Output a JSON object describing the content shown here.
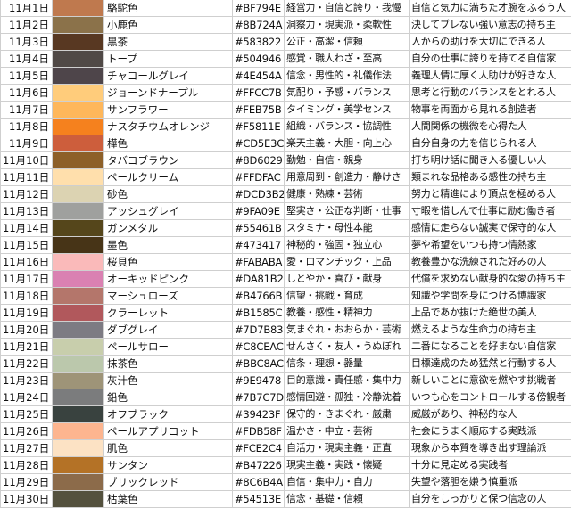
{
  "rows": [
    {
      "date": "11月1日",
      "color": "#BF794E",
      "name": "駱駝色",
      "hex": "#BF794E",
      "traits": "経営力・自信と誇り・我慢",
      "desc": "自信と気力に満ちた才腕をふるう人"
    },
    {
      "date": "11月2日",
      "color": "#8B724A",
      "name": "小鹿色",
      "hex": "#8B724A",
      "traits": "洞察力・現実派・柔軟性",
      "desc": "決してブレない強い意志の持ち主"
    },
    {
      "date": "11月3日",
      "color": "#583822",
      "name": "黒茶",
      "hex": "#583822",
      "traits": "公正・高潔・信頼",
      "desc": "人からの助けを大切にできる人"
    },
    {
      "date": "11月4日",
      "color": "#504946",
      "name": "トープ",
      "hex": "#504946",
      "traits": "感覚・職人わざ・至高",
      "desc": "自分の仕事に誇りを持てる自信家"
    },
    {
      "date": "11月5日",
      "color": "#4E454A",
      "name": "チャコールグレイ",
      "hex": "#4E454A",
      "traits": "信念・男性的・礼儀作法",
      "desc": "義理人情に厚く人助けが好きな人"
    },
    {
      "date": "11月6日",
      "color": "#FFCC7B",
      "name": "ジョーンドナープル",
      "hex": "#FFCC7B",
      "traits": "気配り・予感・バランス",
      "desc": "思考と行動のバランスをとれる人"
    },
    {
      "date": "11月7日",
      "color": "#FEB75B",
      "name": "サンフラワー",
      "hex": "#FEB75B",
      "traits": "タイミング・美学センス",
      "desc": "物事を両面から見れる創造者"
    },
    {
      "date": "11月8日",
      "color": "#F5811E",
      "name": "ナスタチウムオレンジ",
      "hex": "#F5811E",
      "traits": "組織・バランス・協調性",
      "desc": "人間関係の機微を心得た人"
    },
    {
      "date": "11月9日",
      "color": "#CD5E3C",
      "name": "樺色",
      "hex": "#CD5E3C",
      "traits": "楽天主義・大胆・向上心",
      "desc": "自分自身の力を信じられる人"
    },
    {
      "date": "11月10日",
      "color": "#8D6029",
      "name": "タバコブラウン",
      "hex": "#8D6029",
      "traits": "勤勉・自信・親身",
      "desc": "打ち明け話に聞き入る優しい人"
    },
    {
      "date": "11月11日",
      "color": "#FFDFAC",
      "name": "ペールクリーム",
      "hex": "#FFDFAC",
      "traits": "用意周到・創造力・静けさ",
      "desc": "類まれな品格ある感性の持ち主"
    },
    {
      "date": "11月12日",
      "color": "#DCD3B2",
      "name": "砂色",
      "hex": "#DCD3B2",
      "traits": "健康・熟練・芸術",
      "desc": "努力と精進により頂点を極める人"
    },
    {
      "date": "11月13日",
      "color": "#9FA09E",
      "name": "アッシュグレイ",
      "hex": "#9FA09E",
      "traits": "堅実さ・公正な判断・仕事",
      "desc": "寸暇を惜しんで仕事に励む働き者"
    },
    {
      "date": "11月14日",
      "color": "#55461B",
      "name": "ガンメタル",
      "hex": "#55461B",
      "traits": "スタミナ・母性本能",
      "desc": "感情に走らない誠実で保守的な人"
    },
    {
      "date": "11月15日",
      "color": "#473417",
      "name": "墨色",
      "hex": "#473417",
      "traits": "神秘的・強固・独立心",
      "desc": "夢や希望をいつも持つ情熱家"
    },
    {
      "date": "11月16日",
      "color": "#FABABA",
      "name": "桜貝色",
      "hex": "#FABABA",
      "traits": "愛・ロマンチック・上品",
      "desc": "教養豊かな洗練された好みの人"
    },
    {
      "date": "11月17日",
      "color": "#DA81B2",
      "name": "オーキッドピンク",
      "hex": "#DA81B2",
      "traits": "しとやか・喜び・献身",
      "desc": "代償を求めない献身的な愛の持ち主"
    },
    {
      "date": "11月18日",
      "color": "#B4766B",
      "name": "マーシュローズ",
      "hex": "#B4766B",
      "traits": "信望・挑戦・育成",
      "desc": "知識や学問を身につける博識家"
    },
    {
      "date": "11月19日",
      "color": "#B1585C",
      "name": "クラーレット",
      "hex": "#B1585C",
      "traits": "教養・感性・精神力",
      "desc": "上品であか抜けた絶世の美人"
    },
    {
      "date": "11月20日",
      "color": "#7D7B83",
      "name": "ダブグレイ",
      "hex": "#7D7B83",
      "traits": "気まぐれ・おおらか・芸術",
      "desc": "燃えるような生命力の持ち主"
    },
    {
      "date": "11月21日",
      "color": "#C8CEAC",
      "name": "ペールサロー",
      "hex": "#C8CEAC",
      "traits": "せんさく・友人・うぬぼれ",
      "desc": "二番になることを好まない自信家"
    },
    {
      "date": "11月22日",
      "color": "#BBC8AC",
      "name": "抹茶色",
      "hex": "#BBC8AC",
      "traits": "信条・理想・器量",
      "desc": "目標達成のため猛然と行動する人"
    },
    {
      "date": "11月23日",
      "color": "#9E9478",
      "name": "灰汁色",
      "hex": "#9E9478",
      "traits": "目的意識・責任感・集中力",
      "desc": "新しいことに意欲を燃やす挑戦者"
    },
    {
      "date": "11月24日",
      "color": "#7B7C7D",
      "name": "鉛色",
      "hex": "#7B7C7D",
      "traits": "感情回避・孤独・冷静沈着",
      "desc": "いつも心をコントロールする傍観者"
    },
    {
      "date": "11月25日",
      "color": "#39423F",
      "name": "オフブラック",
      "hex": "#39423F",
      "traits": "保守的・きまぐれ・厳粛",
      "desc": "威厳があり、神秘的な人"
    },
    {
      "date": "11月26日",
      "color": "#FDB58F",
      "name": "ペールアプリコット",
      "hex": "#FDB58F",
      "traits": "温かさ・中立・芸術",
      "desc": "社会にうまく順応する実践派"
    },
    {
      "date": "11月27日",
      "color": "#FCE2C4",
      "name": "肌色",
      "hex": "#FCE2C4",
      "traits": "自活力・現実主義・正直",
      "desc": "現象から本質を導き出す理論派"
    },
    {
      "date": "11月28日",
      "color": "#B47226",
      "name": "サンタン",
      "hex": "#B47226",
      "traits": "現実主義・実践・懐疑",
      "desc": "十分に見定める実践者"
    },
    {
      "date": "11月29日",
      "color": "#8C6B4A",
      "name": "ブリックレッド",
      "hex": "#8C6B4A",
      "traits": "自信・集中力・自力",
      "desc": "失望や落胆を嫌う慎重派"
    },
    {
      "date": "11月30日",
      "color": "#54513E",
      "name": "枯葉色",
      "hex": "#54513E",
      "traits": "信念・基礎・信頼",
      "desc": "自分をしっかりと保つ信念の人"
    }
  ]
}
